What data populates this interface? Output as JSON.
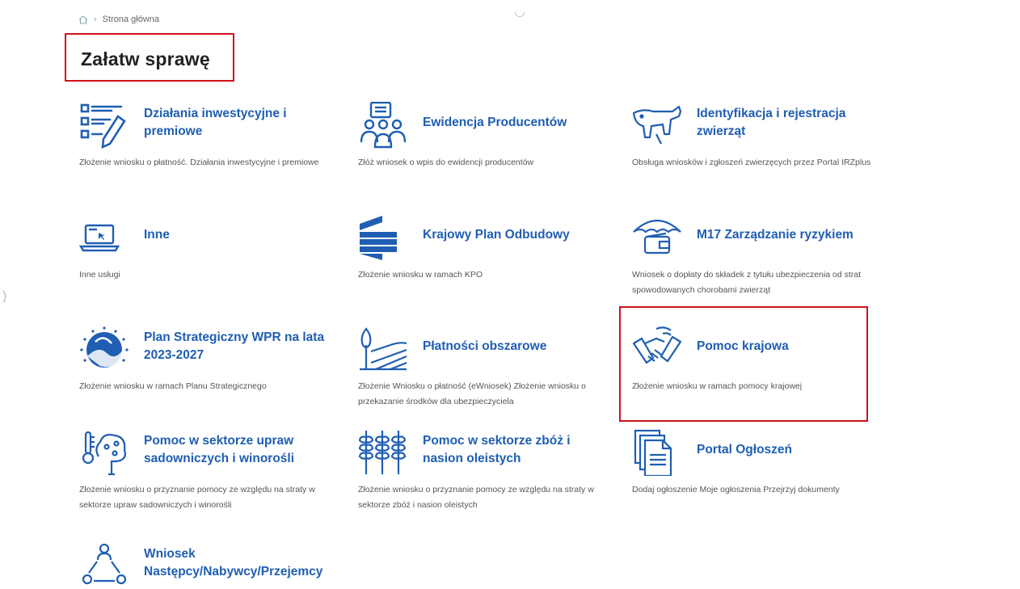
{
  "breadcrumb": {
    "current": "Strona główna"
  },
  "page": {
    "title": "Załatw sprawę"
  },
  "colors": {
    "link": "#1f5eb3",
    "icon": "#1f5eb3",
    "highlight": "#d0111b"
  },
  "tiles": [
    {
      "title": "Działania inwestycyjne i premiowe",
      "desc": "Złożenie wniosku o płatność. Działania inwestycyjne i premiowe",
      "icon": "form-edit-icon"
    },
    {
      "title": "Ewidencja Producentów",
      "desc": "Złóż wniosek o wpis do ewidencji producentów",
      "icon": "people-icon"
    },
    {
      "title": "Identyfikacja i rejestracja zwierząt",
      "desc": "Obsługa wniosków i zgłoszeń zwierzęcych przez Portal IRZplus",
      "icon": "cow-icon"
    },
    {
      "title": "Inne",
      "desc": "Inne usługi",
      "icon": "laptop-icon"
    },
    {
      "title": "Krajowy Plan Odbudowy",
      "desc": "Złożenie wniosku w ramach KPO",
      "icon": "kpo-logo-icon"
    },
    {
      "title": "M17 Zarządzanie ryzykiem",
      "desc": "Wniosek o dopłaty do składek z tytułu ubezpieczenia od strat spowodowanych chorobami zwierząt",
      "icon": "umbrella-wallet-icon"
    },
    {
      "title": "Plan Strategiczny WPR na lata 2023-2027",
      "desc": "Złożenie wniosku w ramach Planu Strategicznego",
      "icon": "wpr-logo-icon"
    },
    {
      "title": "Płatności obszarowe",
      "desc": "Złożenie Wniosku o płatność (eWniosek) Złożenie wniosku o przekazanie środków dla ubezpieczyciela",
      "icon": "field-tree-icon"
    },
    {
      "title": "Pomoc krajowa",
      "desc": "Złożenie wniosku w ramach pomocy krajowej",
      "icon": "handshake-icon"
    },
    {
      "title": "Pomoc w sektorze upraw sadowniczych i winorośli",
      "desc": "Złożenie wniosku o przyznanie pomocy ze względu na straty w sektorze upraw sadowniczych i winorośli",
      "icon": "fruit-tree-icon"
    },
    {
      "title": "Pomoc w sektorze zbóż i nasion oleistych",
      "desc": "Złożenie wniosku o przyznanie pomocy ze względu na straty w sektorze zbóż i nasion oleistych",
      "icon": "wheat-icon"
    },
    {
      "title": "Portal Ogłoszeń",
      "desc": "Dodaj ogłoszenie Moje ogłoszenia Przejrzyj dokumenty",
      "icon": "documents-icon"
    },
    {
      "title": "Wniosek Następcy/Nabywcy/Przejemcy",
      "desc": "",
      "icon": "cycle-people-icon"
    }
  ]
}
